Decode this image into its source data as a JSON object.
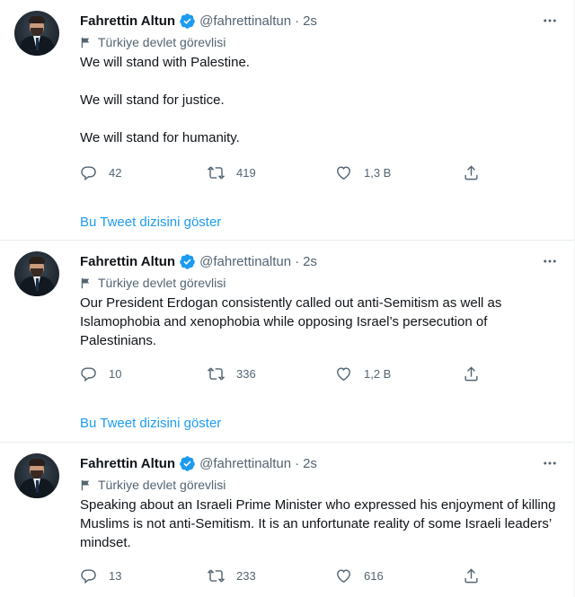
{
  "colors": {
    "accent": "#1d9bf0",
    "verified": "#1d9bf0",
    "secondary_text": "#536471",
    "divider": "#e6ecf0"
  },
  "tweets": [
    {
      "author_name": "Fahrettin Altun",
      "handle": "@fahrettinaltun",
      "separator": "·",
      "time": "2s",
      "label": "Türkiye devlet görevlisi",
      "paragraphs": [
        "We will stand with Palestine.",
        "We will stand for justice.",
        "We will stand for humanity."
      ],
      "replies": "42",
      "retweets": "419",
      "likes": "1,3 B",
      "show_thread": "Bu Tweet dizisini göster"
    },
    {
      "author_name": "Fahrettin Altun",
      "handle": "@fahrettinaltun",
      "separator": "·",
      "time": "2s",
      "label": "Türkiye devlet görevlisi",
      "paragraphs": [
        "Our President Erdogan consistently called out anti-Semitism as well as Islamophobia and xenophobia while opposing Israel’s persecution of Palestinians."
      ],
      "replies": "10",
      "retweets": "336",
      "likes": "1,2 B",
      "show_thread": "Bu Tweet dizisini göster"
    },
    {
      "author_name": "Fahrettin Altun",
      "handle": "@fahrettinaltun",
      "separator": "·",
      "time": "2s",
      "label": "Türkiye devlet görevlisi",
      "paragraphs": [
        "Speaking about an Israeli Prime Minister who expressed his enjoyment of killing Muslims is not anti-Semitism. It is an unfortunate reality of some Israeli leaders’ mindset."
      ],
      "replies": "13",
      "retweets": "233",
      "likes": "616"
    }
  ],
  "icons": {
    "more": "more-icon",
    "verified": "verified-badge-icon",
    "label": "flag-icon",
    "reply": "reply-icon",
    "retweet": "retweet-icon",
    "like": "like-icon",
    "share": "share-icon"
  }
}
